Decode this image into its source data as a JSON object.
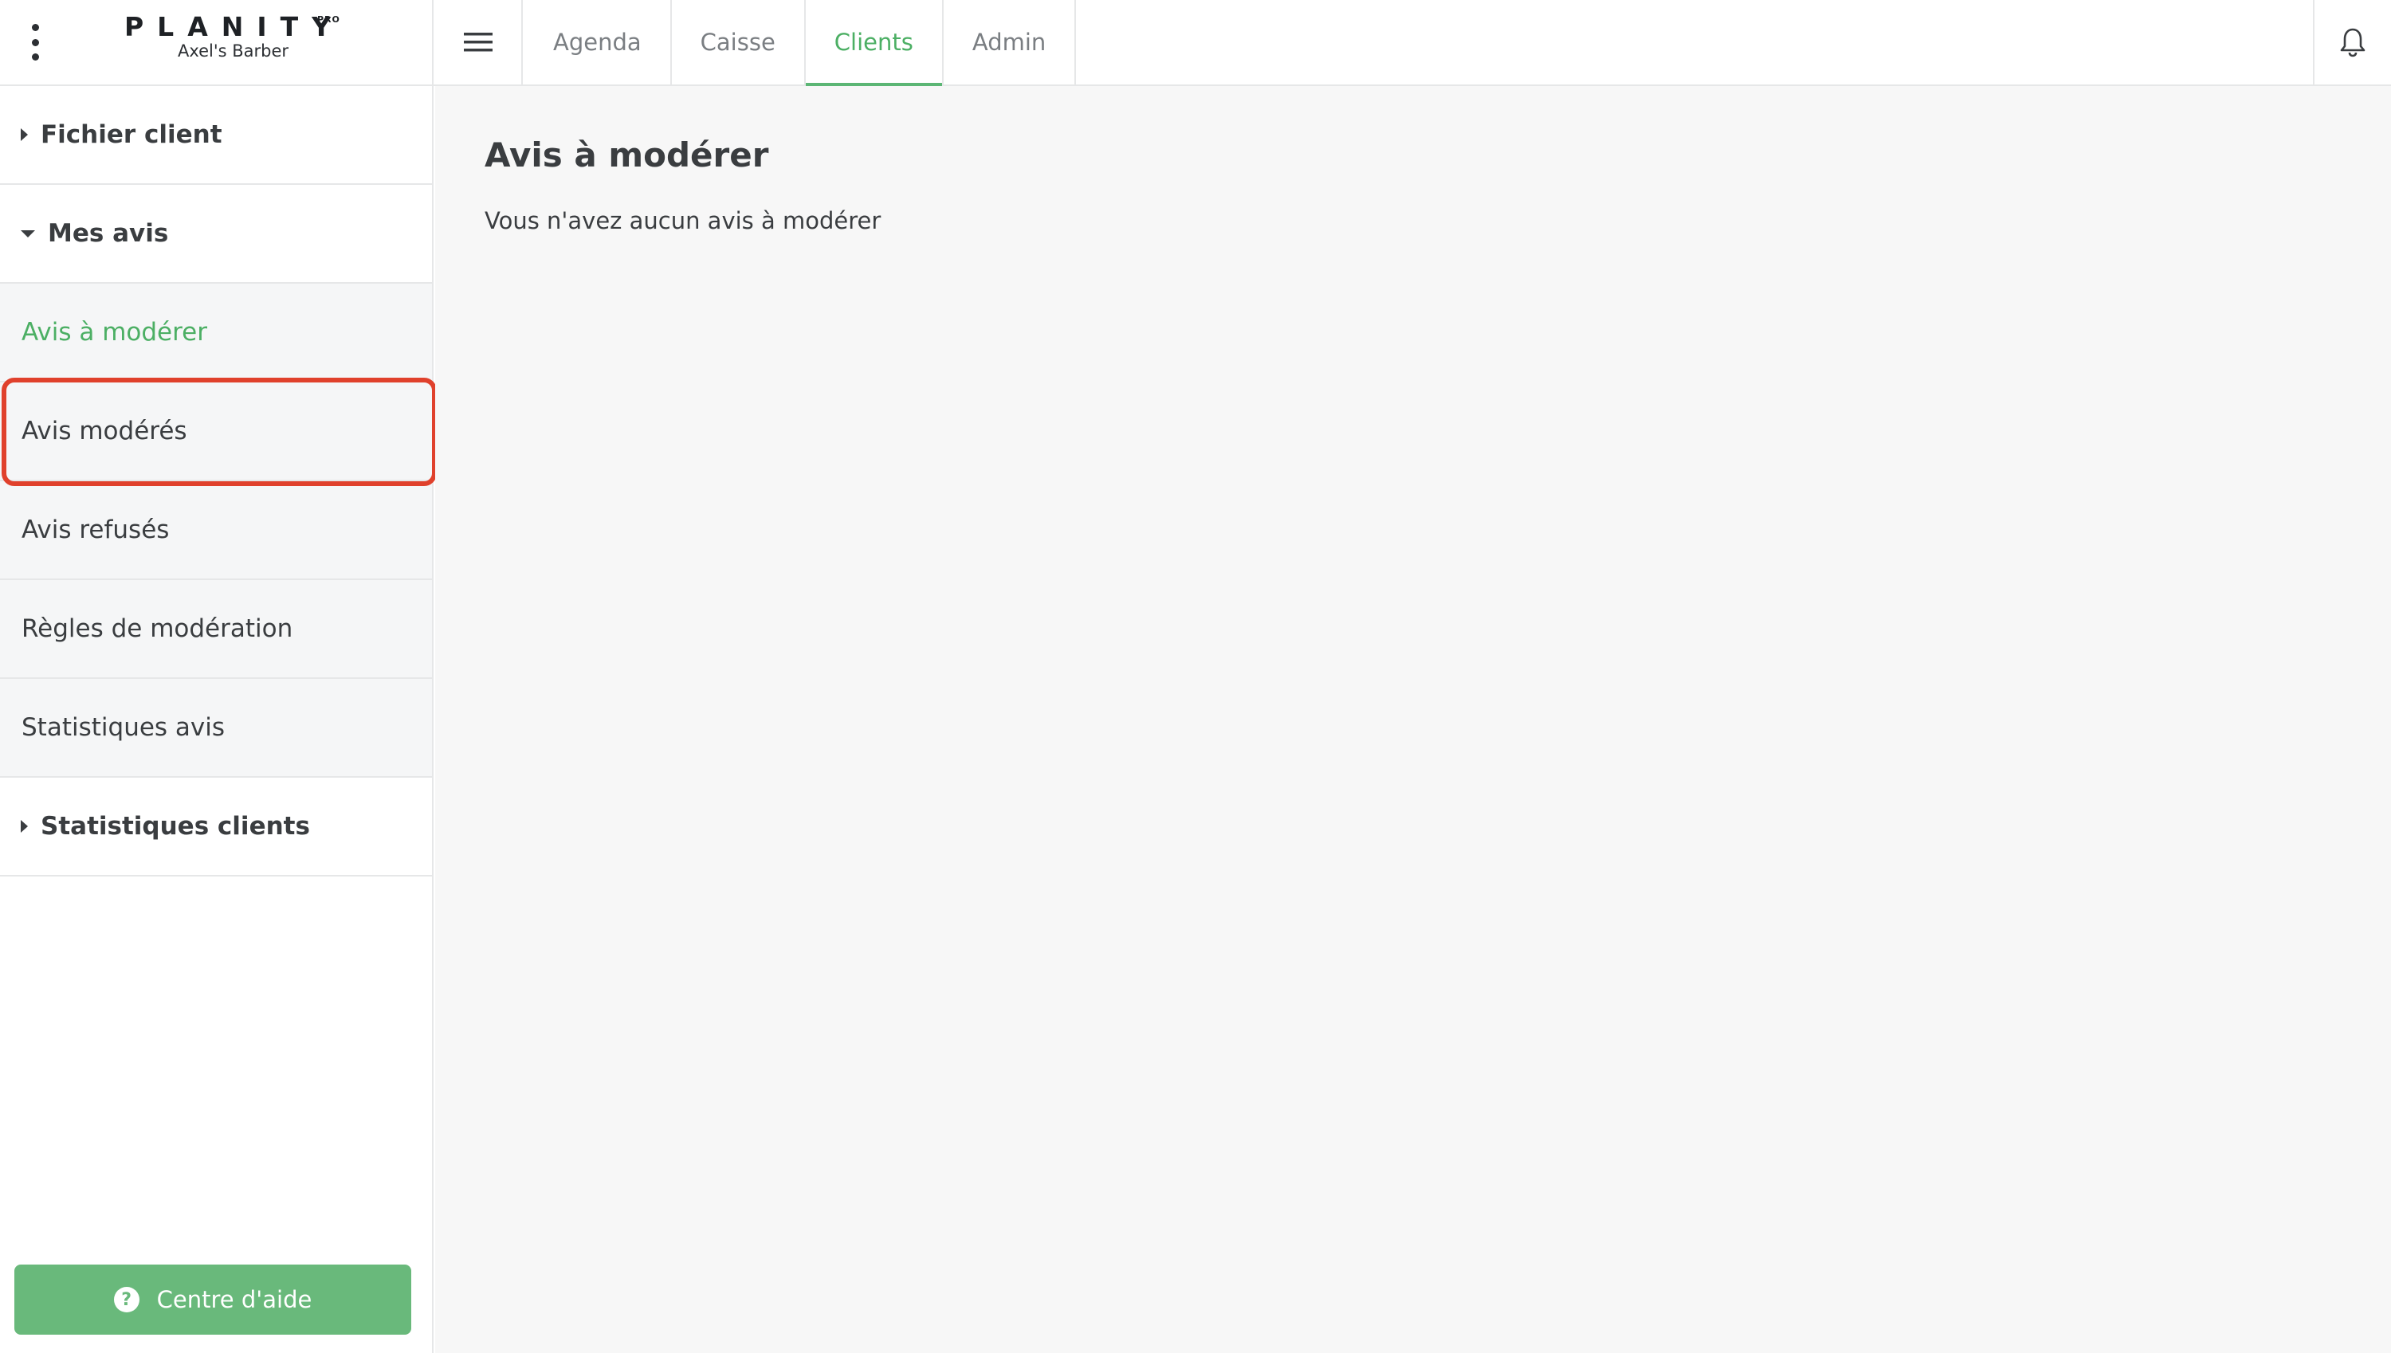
{
  "brand": {
    "logo_text": "PLANITY",
    "logo_badge": "PRO",
    "salon_name": "Axel's Barber"
  },
  "topnav": {
    "tabs": [
      {
        "label": "Agenda",
        "active": false
      },
      {
        "label": "Caisse",
        "active": false
      },
      {
        "label": "Clients",
        "active": true
      },
      {
        "label": "Admin",
        "active": false
      }
    ],
    "icons": [
      "kebab-menu-icon",
      "hamburger-icon",
      "bell-icon"
    ]
  },
  "sidebar": {
    "sections": [
      {
        "label": "Fichier client",
        "expanded": false
      },
      {
        "label": "Mes avis",
        "expanded": true
      },
      {
        "label": "Statistiques clients",
        "expanded": false
      }
    ],
    "subitems": [
      {
        "label": "Avis à modérer",
        "active": true
      },
      {
        "label": "Avis modérés",
        "active": false,
        "highlighted": true
      },
      {
        "label": "Avis refusés",
        "active": false
      },
      {
        "label": "Règles de modération",
        "active": false
      },
      {
        "label": "Statistiques avis",
        "active": false
      }
    ],
    "help_button": {
      "label": "Centre d'aide",
      "icon": "question-circle-icon"
    }
  },
  "main": {
    "title": "Avis à modérer",
    "empty_message": "Vous n'avez aucun avis à modérer"
  },
  "colors": {
    "accent": "#4caf64",
    "help_button": "#69b97b",
    "highlight": "#e0412c",
    "main_bg": "#f7f7f7"
  }
}
